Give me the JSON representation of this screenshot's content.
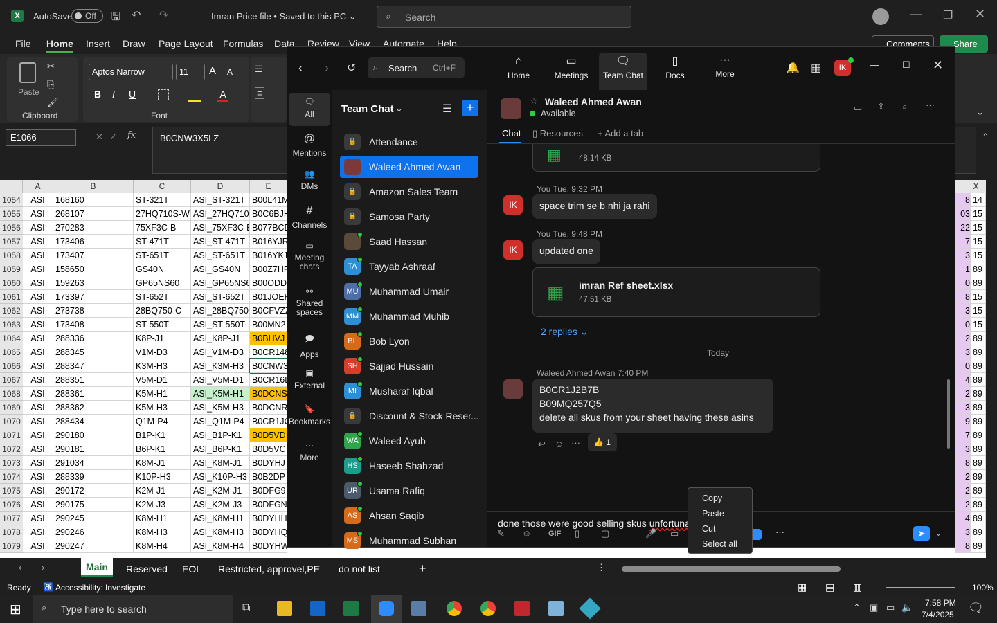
{
  "excel": {
    "autosave": "AutoSave",
    "autosave_state": "Off",
    "file_title": "Imran Price file • Saved to this PC ⌄",
    "search_placeholder": "Search",
    "comments": "Comments",
    "share": "Share",
    "tabs": [
      "File",
      "Home",
      "Insert",
      "Draw",
      "Page Layout",
      "Formulas",
      "Data",
      "Review",
      "View",
      "Automate",
      "Help"
    ],
    "font_name": "Aptos Narrow",
    "font_size": "11",
    "paste": "Paste",
    "clipboard": "Clipboard",
    "font": "Font",
    "name_box": "E1066",
    "formula": "B0CNW3X5LZ",
    "columns": [
      "A",
      "B",
      "C",
      "D",
      "E",
      "X"
    ],
    "rows": [
      [
        "1054",
        "ASI",
        "168160",
        "ST-321T",
        "ASI_ST-321T",
        "B00L41M",
        "8",
        "14"
      ],
      [
        "1055",
        "ASI",
        "268107",
        "27HQ710S-W",
        "ASI_27HQ710S",
        "B0C6BJH",
        "03",
        "15"
      ],
      [
        "1056",
        "ASI",
        "270283",
        "75XF3C-B",
        "ASI_75XF3C-B",
        "B077BCD",
        "22",
        "15"
      ],
      [
        "1057",
        "ASI",
        "173406",
        "ST-471T",
        "ASI_ST-471T",
        "B016YJR",
        "7",
        "15"
      ],
      [
        "1058",
        "ASI",
        "173407",
        "ST-651T",
        "ASI_ST-651T",
        "B016YK1",
        "3",
        "15"
      ],
      [
        "1059",
        "ASI",
        "158650",
        "GS40N",
        "ASI_GS40N",
        "B00Z7HF",
        "1",
        "89"
      ],
      [
        "1060",
        "ASI",
        "159263",
        "GP65NS60",
        "ASI_GP65NS6",
        "B00ODD",
        "0",
        "89"
      ],
      [
        "1061",
        "ASI",
        "173397",
        "ST-652T",
        "ASI_ST-652T",
        "B01JOEK",
        "8",
        "15"
      ],
      [
        "1062",
        "ASI",
        "273738",
        "28BQ750-C",
        "ASI_28BQ750-",
        "B0CFVZZ",
        "3",
        "15"
      ],
      [
        "1063",
        "ASI",
        "173408",
        "ST-550T",
        "ASI_ST-550T",
        "B00MN2",
        "0",
        "15"
      ],
      [
        "1064",
        "ASI",
        "288336",
        "K8P-J1",
        "ASI_K8P-J1",
        "B0BHVJ",
        "2",
        "89"
      ],
      [
        "1065",
        "ASI",
        "288345",
        "V1M-D3",
        "ASI_V1M-D3",
        "B0CR148",
        "3",
        "89"
      ],
      [
        "1066",
        "ASI",
        "288347",
        "K3M-H3",
        "ASI_K3M-H3",
        "B0CNW3",
        "0",
        "89"
      ],
      [
        "1067",
        "ASI",
        "288351",
        "V5M-D1",
        "ASI_V5M-D1",
        "B0CR16L",
        "4",
        "89"
      ],
      [
        "1068",
        "ASI",
        "288361",
        "K5M-H1",
        "ASI_K5M-H1",
        "B0DCNS",
        "2",
        "89"
      ],
      [
        "1069",
        "ASI",
        "288362",
        "K5M-H3",
        "ASI_K5M-H3",
        "B0DCNR",
        "3",
        "89"
      ],
      [
        "1070",
        "ASI",
        "288434",
        "Q1M-P4",
        "ASI_Q1M-P4",
        "B0CR1JC",
        "9",
        "89"
      ],
      [
        "1071",
        "ASI",
        "290180",
        "B1P-K1",
        "ASI_B1P-K1",
        "B0D5VD",
        "7",
        "89"
      ],
      [
        "1072",
        "ASI",
        "290181",
        "B6P-K1",
        "ASI_B6P-K1",
        "B0D5VC",
        "3",
        "89"
      ],
      [
        "1073",
        "ASI",
        "291034",
        "K8M-J1",
        "ASI_K8M-J1",
        "B0DYHJ",
        "8",
        "89"
      ],
      [
        "1074",
        "ASI",
        "288339",
        "K10P-H3",
        "ASI_K10P-H3",
        "B0B2DP",
        "2",
        "89"
      ],
      [
        "1075",
        "ASI",
        "290172",
        "K2M-J1",
        "ASI_K2M-J1",
        "B0DFG9",
        "2",
        "89"
      ],
      [
        "1076",
        "ASI",
        "290175",
        "K2M-J3",
        "ASI_K2M-J3",
        "B0DFGN",
        "2",
        "89"
      ],
      [
        "1077",
        "ASI",
        "290245",
        "K8M-H1",
        "ASI_K8M-H1",
        "B0DYHH",
        "4",
        "89"
      ],
      [
        "1078",
        "ASI",
        "290246",
        "K8M-H3",
        "ASI_K8M-H3",
        "B0DYHQ",
        "3",
        "89"
      ],
      [
        "1079",
        "ASI",
        "290247",
        "K8M-H4",
        "ASI_K8M-H4",
        "B0DYHW",
        "8",
        "89"
      ]
    ],
    "sheet_tabs": [
      "Main",
      "Reserved",
      "EOL",
      "Restricted, approvel,PE",
      "do not list"
    ],
    "status_ready": "Ready",
    "status_access": "Accessibility: Investigate",
    "zoom": "100%"
  },
  "zoom": {
    "search": "Search",
    "search_shortcut": "Ctrl+F",
    "avatar_initials": "IK",
    "nav": [
      "Home",
      "Meetings",
      "Team Chat",
      "Docs",
      "More"
    ],
    "rail": [
      "All",
      "Mentions",
      "DMs",
      "Channels",
      "Meeting chats",
      "Shared spaces",
      "Apps",
      "External",
      "Bookmarks",
      "More"
    ],
    "list_title": "Team Chat",
    "contacts": [
      {
        "name": "Attendance",
        "initials": "",
        "color": "#3a3a3a",
        "lock": true
      },
      {
        "name": "Waleed Ahmed Awan",
        "initials": "",
        "color": "#7a3a3a",
        "lock": false
      },
      {
        "name": "Amazon Sales Team",
        "initials": "",
        "color": "#3a3a3a",
        "lock": true
      },
      {
        "name": "Samosa Party",
        "initials": "",
        "color": "#3a3a3a",
        "lock": true
      },
      {
        "name": "Saad Hassan",
        "initials": "",
        "color": "#5a4a3a",
        "lock": false
      },
      {
        "name": "Tayyab Ashraaf",
        "initials": "TA",
        "color": "#2d8fd5",
        "lock": false
      },
      {
        "name": "Muhammad Umair",
        "initials": "MU",
        "color": "#4f6ea8",
        "lock": false
      },
      {
        "name": "Muhammad Muhib",
        "initials": "MM",
        "color": "#2d8fd5",
        "lock": false
      },
      {
        "name": "Bob Lyon",
        "initials": "BL",
        "color": "#d46a1a",
        "lock": false
      },
      {
        "name": "Sajjad Hussain",
        "initials": "SH",
        "color": "#d0402b",
        "lock": false
      },
      {
        "name": "Musharaf Iqbal",
        "initials": "MI",
        "color": "#2d8fd5",
        "lock": false
      },
      {
        "name": "Discount & Stock Reser...",
        "initials": "",
        "color": "#3a3a3a",
        "lock": true
      },
      {
        "name": "Waleed Ayub",
        "initials": "WA",
        "color": "#2ea54a",
        "lock": false
      },
      {
        "name": "Haseeb Shahzad",
        "initials": "HS",
        "color": "#1c9e8c",
        "lock": false
      },
      {
        "name": "Usama Rafiq",
        "initials": "UR",
        "color": "#4a5a6a",
        "lock": false
      },
      {
        "name": "Ahsan Saqib",
        "initials": "AS",
        "color": "#d46a1a",
        "lock": false
      },
      {
        "name": "Muhammad Subhan",
        "initials": "MS",
        "color": "#d46a1a",
        "lock": false
      }
    ],
    "chat_name": "Waleed Ahmed Awan",
    "chat_status": "Available",
    "chat_tabs": [
      "Chat",
      "Resources",
      "Add a tab"
    ],
    "messages": {
      "file1_size": "48.14 KB",
      "m1_meta": "You Tue, 9:32 PM",
      "m1_text": "space trim se b nhi ja rahi",
      "m2_meta": "You Tue, 9:48 PM",
      "m2_text": "updated one",
      "file2_name": "imran Ref sheet.xlsx",
      "file2_size": "47.51 KB",
      "replies": "2 replies ⌄",
      "divider": "Today",
      "m3_meta": "Waleed Ahmed Awan 7:40 PM",
      "m3_line1": "B0CR1J2B7B",
      "m3_line2": "B09MQ257Q5",
      "m3_line3": "delete all skus from your sheet having these asins",
      "reaction_count": "1"
    },
    "compose": {
      "text_pre": "done those were good selling skus ",
      "text_err": "unfortunaly"
    },
    "context_menu": [
      "Copy",
      "Paste",
      "Cut",
      "Select all"
    ]
  },
  "taskbar": {
    "search": "Type here to search",
    "time": "7:58 PM",
    "date": "7/4/2025"
  }
}
